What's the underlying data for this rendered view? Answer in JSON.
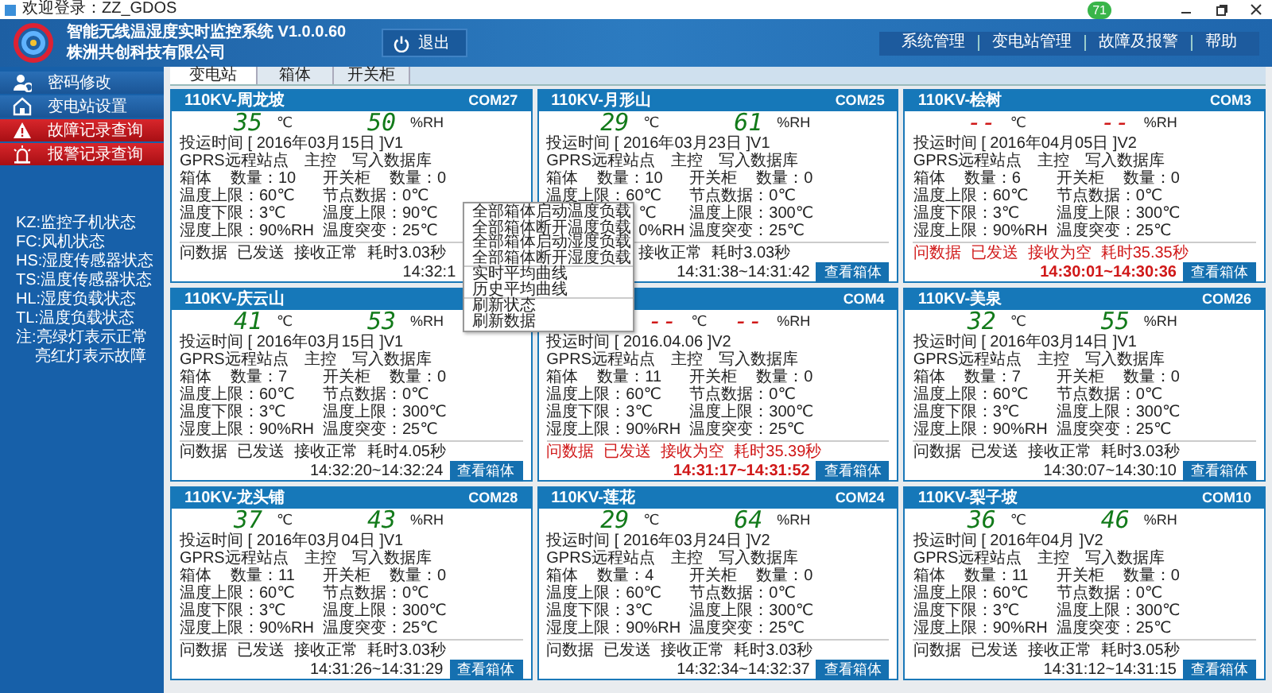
{
  "window": {
    "title": "欢迎登录：ZZ_GDOS",
    "badge": "71"
  },
  "header": {
    "title": "智能无线温湿度实时监控系统 V1.0.0.60",
    "company": "株洲共创科技有限公司",
    "exit_button": "退出",
    "nav": [
      "系统管理",
      "变电站管理",
      "故障及报警",
      "帮助"
    ]
  },
  "sidebar": {
    "items": [
      {
        "label": "密码修改",
        "kind": "normal"
      },
      {
        "label": "变电站设置",
        "kind": "normal"
      },
      {
        "label": "故障记录查询",
        "kind": "alert"
      },
      {
        "label": "报警记录查询",
        "kind": "alert"
      }
    ],
    "legend": [
      "KZ:监控子机状态",
      "FC:风机状态",
      "HS:湿度传感器状态",
      "TS:温度传感器状态",
      "HL:湿度负载状态",
      "TL:温度负载状态",
      "注:亮绿灯表示正常",
      "亮红灯表示故障"
    ]
  },
  "tabs": [
    {
      "label": "变电站",
      "selected": true
    },
    {
      "label": "箱体",
      "selected": false
    },
    {
      "label": "开关柜",
      "selected": false
    }
  ],
  "cards": [
    {
      "title": "110KV-周龙坡",
      "port": "COM27",
      "temp": "35",
      "temp_unit": "℃",
      "hum": "50",
      "hum_unit": "%RH",
      "install": "投运时间 [ 2016年03月15日 ]V1",
      "gprs": "GPRS远程站点",
      "master": "主控",
      "db": "写入数据库",
      "box_label": "箱体",
      "box_count": "数量：10",
      "cab_label": "开关柜",
      "cab_count": "数量：0",
      "left": [
        "温度上限：60℃",
        "温度下限：3℃",
        "湿度上限：90%RH"
      ],
      "right": [
        "节点数据：0℃",
        "温度上限：90℃",
        "温度突变：25℃"
      ],
      "alarm": false,
      "footer": [
        "问数据",
        "已发送",
        "接收正常",
        "耗时3.03秒"
      ],
      "time": {
        "text": "14:32:1",
        "cut": true
      }
    },
    {
      "title": "110KV-月形山",
      "port": "COM25",
      "temp": "29",
      "temp_unit": "℃",
      "hum": "61",
      "hum_unit": "%RH",
      "install": "投运时间 [ 2016年03月23日 ]V1",
      "gprs": "GPRS远程站点",
      "master": "主控",
      "db": "写入数据库",
      "box_label": "箱体",
      "box_count": "数量：10",
      "cab_label": "开关柜",
      "cab_count": "数量：0",
      "left": [
        "温度上限：60℃",
        {
          "text": "℃",
          "cut": true
        },
        {
          "text": "0%RH",
          "cut": true
        }
      ],
      "right": [
        "节点数据：0℃",
        "温度上限：300℃",
        "温度突变：25℃"
      ],
      "alarm": false,
      "footer": [
        {
          "text": "接收正常",
          "cut": true
        },
        "耗时3.03秒"
      ],
      "time": "14:31:38~14:31:42",
      "button": "查看箱体"
    },
    {
      "title": "110KV-桧树",
      "port": "COM3",
      "temp": "--",
      "temp_unit": "℃",
      "hum": "--",
      "hum_unit": "%RH",
      "install": "投运时间 [ 2016年04月05日 ]V2",
      "gprs": "GPRS远程站点",
      "master": "主控",
      "db": "写入数据库",
      "box_label": "箱体",
      "box_count": "数量：6",
      "cab_label": "开关柜",
      "cab_count": "数量：0",
      "left": [
        "温度上限：60℃",
        "温度下限：3℃",
        "湿度上限：90%RH"
      ],
      "right": [
        "节点数据：0℃",
        "温度上限：300℃",
        "温度突变：25℃"
      ],
      "alarm": true,
      "footer": [
        "问数据",
        "已发送",
        "接收为空",
        "耗时35.35秒"
      ],
      "time": "14:30:01~14:30:36",
      "button": "查看箱体"
    },
    {
      "title": "110KV-庆云山",
      "temp": "41",
      "temp_unit": "℃",
      "hum": "53",
      "hum_unit": "%RH",
      "install": "投运时间 [ 2016年03月15日 ]V1",
      "gprs": "GPRS远程站点",
      "master": "主控",
      "db": "写入数据库",
      "box_label": "箱体",
      "box_count": "数量：7",
      "cab_label": "开关柜",
      "cab_count": "数量：0",
      "left": [
        "温度上限：60℃",
        "温度下限：3℃",
        "湿度上限：90%RH"
      ],
      "right": [
        "节点数据：0℃",
        "温度上限：300℃",
        "温度突变：25℃"
      ],
      "alarm": false,
      "footer": [
        "问数据",
        "已发送",
        "接收正常",
        "耗时4.05秒"
      ],
      "time": "14:32:20~14:32:24",
      "button": "查看箱体"
    },
    {
      "port": "COM4",
      "temp": {
        "text": "--",
        "cut": true
      },
      "temp_unit": "℃",
      "hum": "--",
      "hum_unit": "%RH",
      "install": "投运时间 [ 2016.04.06 ]V2",
      "gprs": "GPRS远程站点",
      "master": "主控",
      "db": "写入数据库",
      "box_label": "箱体",
      "box_count": "数量：11",
      "cab_label": "开关柜",
      "cab_count": "数量：0",
      "left": [
        "温度上限：60℃",
        "温度下限：3℃",
        "湿度上限：90%RH"
      ],
      "right": [
        "节点数据：0℃",
        "温度上限：300℃",
        "温度突变：25℃"
      ],
      "alarm": true,
      "footer": [
        "问数据",
        "已发送",
        "接收为空",
        "耗时35.39秒"
      ],
      "time": "14:31:17~14:31:52",
      "button": "查看箱体"
    },
    {
      "title": "110KV-美泉",
      "port": "COM26",
      "temp": "32",
      "temp_unit": "℃",
      "hum": "55",
      "hum_unit": "%RH",
      "install": "投运时间 [ 2016年03月14日 ]V1",
      "gprs": "GPRS远程站点",
      "master": "主控",
      "db": "写入数据库",
      "box_label": "箱体",
      "box_count": "数量：7",
      "cab_label": "开关柜",
      "cab_count": "数量：0",
      "left": [
        "温度上限：60℃",
        "温度下限：3℃",
        "湿度上限：90%RH"
      ],
      "right": [
        "节点数据：0℃",
        "温度上限：300℃",
        "温度突变：25℃"
      ],
      "alarm": false,
      "footer": [
        "问数据",
        "已发送",
        "接收正常",
        "耗时3.03秒"
      ],
      "time": "14:30:07~14:30:10",
      "button": "查看箱体"
    },
    {
      "title": "110KV-龙头铺",
      "port": "COM28",
      "temp": "37",
      "temp_unit": "℃",
      "hum": "43",
      "hum_unit": "%RH",
      "install": "投运时间 [ 2016年03月04日 ]V1",
      "gprs": "GPRS远程站点",
      "master": "主控",
      "db": "写入数据库",
      "box_label": "箱体",
      "box_count": "数量：11",
      "cab_label": "开关柜",
      "cab_count": "数量：0",
      "left": [
        "温度上限：60℃",
        "温度下限：3℃",
        "湿度上限：90%RH"
      ],
      "right": [
        "节点数据：0℃",
        "温度上限：300℃",
        "温度突变：25℃"
      ],
      "alarm": false,
      "footer": [
        "问数据",
        "已发送",
        "接收正常",
        "耗时3.03秒"
      ],
      "time": "14:31:26~14:31:29",
      "button": "查看箱体"
    },
    {
      "title": "110KV-莲花",
      "port": "COM24",
      "temp": "29",
      "temp_unit": "℃",
      "hum": "64",
      "hum_unit": "%RH",
      "install": "投运时间 [ 2016年03月24日 ]V2",
      "gprs": "GPRS远程站点",
      "master": "主控",
      "db": "写入数据库",
      "box_label": "箱体",
      "box_count": "数量：4",
      "cab_label": "开关柜",
      "cab_count": "数量：0",
      "left": [
        "温度上限：60℃",
        "温度下限：3℃",
        "湿度上限：90%RH"
      ],
      "right": [
        "节点数据：0℃",
        "温度上限：300℃",
        "温度突变：25℃"
      ],
      "alarm": false,
      "footer": [
        "问数据",
        "已发送",
        "接收正常",
        "耗时3.03秒"
      ],
      "time": "14:32:34~14:32:37",
      "button": "查看箱体"
    },
    {
      "title": "110KV-梨子坡",
      "port": "COM10",
      "temp": "36",
      "temp_unit": "℃",
      "hum": "46",
      "hum_unit": "%RH",
      "install": "投运时间 [ 2016年04月 ]V2",
      "gprs": "GPRS远程站点",
      "master": "主控",
      "db": "写入数据库",
      "box_label": "箱体",
      "box_count": "数量：11",
      "cab_label": "开关柜",
      "cab_count": "数量：0",
      "left": [
        "温度上限：60℃",
        "温度下限：3℃",
        "湿度上限：90%RH"
      ],
      "right": [
        "节点数据：0℃",
        "温度上限：300℃",
        "温度突变：25℃"
      ],
      "alarm": false,
      "footer": [
        "问数据",
        "已发送",
        "接收正常",
        "耗时3.05秒"
      ],
      "time": "14:31:12~14:31:15",
      "button": "查看箱体"
    }
  ],
  "context_menu": [
    {
      "label": "全部箱体启动温度负载",
      "separator_before": false
    },
    {
      "label": "全部箱体断开温度负载",
      "separator_before": false
    },
    {
      "label": "全部箱体启动湿度负载",
      "separator_before": false
    },
    {
      "label": "全部箱体断开湿度负载",
      "separator_before": false
    },
    {
      "label": "实时平均曲线",
      "separator_before": true
    },
    {
      "label": "历史平均曲线",
      "separator_before": false
    },
    {
      "label": "刷新状态",
      "separator_before": true
    },
    {
      "label": "刷新数据",
      "separator_before": false
    }
  ]
}
